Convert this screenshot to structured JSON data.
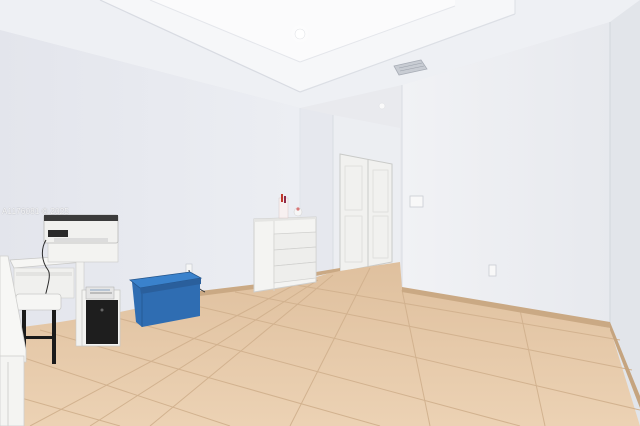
{
  "watermark": {
    "text": "A1176081 © 2025"
  },
  "colors": {
    "wall": "#edeef3",
    "ceiling": "#f2f3f6",
    "floor_tile": "#e6c8a8",
    "grout": "#d5b592",
    "baseboard": "#c9a985",
    "storage_bin": "#2f6fb5",
    "dresser": "#f4f4f2",
    "closet_door": "#f3f3f1"
  }
}
